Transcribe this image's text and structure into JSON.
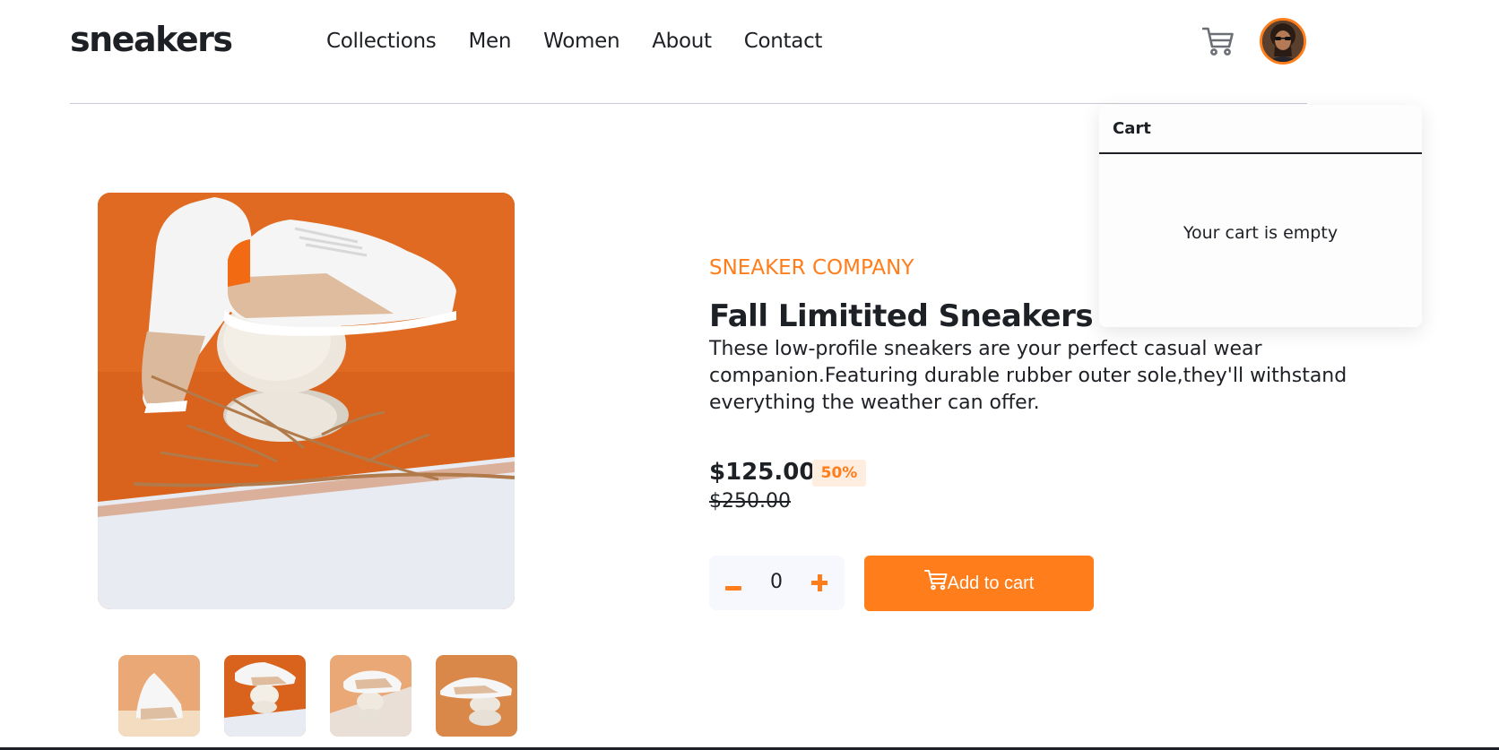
{
  "brand": {
    "logo": "sneakers"
  },
  "nav": {
    "items": [
      {
        "label": "Collections"
      },
      {
        "label": "Men"
      },
      {
        "label": "Women"
      },
      {
        "label": "About"
      },
      {
        "label": "Contact"
      }
    ]
  },
  "header": {
    "cart_icon": "cart-icon",
    "avatar": "user-avatar"
  },
  "gallery": {
    "active_index": 1,
    "thumbnails": [
      "thumbnail-1",
      "thumbnail-2",
      "thumbnail-3",
      "thumbnail-4"
    ]
  },
  "product": {
    "company": "SNEAKER COMPANY",
    "title": "Fall Limitited Sneakers",
    "description": "These low-profile sneakers are your perfect casual wear companion.Featuring durable rubber outer sole,they'll withstand everything the weather can offer.",
    "price": "$125.00",
    "discount": "50%",
    "original_price": "$250.00"
  },
  "quantity": {
    "value": "0",
    "minus_icon": "minus-icon",
    "plus_icon": "plus-icon"
  },
  "add_to_cart": {
    "label": "Add to cart",
    "icon": "cart-icon"
  },
  "cart_panel": {
    "title": "Cart",
    "empty_message": "Your cart is empty"
  },
  "colors": {
    "accent": "#ff7e1b",
    "accent_pale": "#ffede0",
    "text": "#1d2025",
    "panel_bg": "#f6f8fd"
  }
}
